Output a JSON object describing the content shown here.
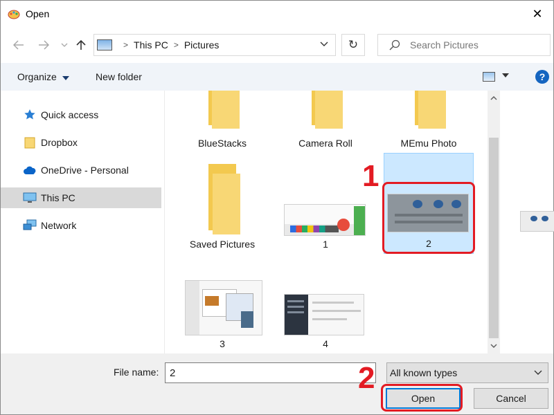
{
  "window": {
    "title": "Open",
    "close_glyph": "✕",
    "icon": "paint-app-icon"
  },
  "nav": {
    "back_icon": "back-arrow-icon",
    "forward_icon": "forward-arrow-icon",
    "recent_icon": "chevron-down-icon",
    "up_icon": "up-arrow-icon",
    "breadcrumb": [
      "This PC",
      "Pictures"
    ],
    "refresh_glyph": "↻",
    "search_placeholder": "Search Pictures"
  },
  "toolbar": {
    "organize_label": "Organize",
    "new_folder_label": "New folder",
    "help_label": "?"
  },
  "sidebar": {
    "items": [
      {
        "label": "Quick access",
        "icon": "star-icon",
        "selected": false
      },
      {
        "label": "Dropbox",
        "icon": "folder-icon",
        "selected": false
      },
      {
        "label": "OneDrive - Personal",
        "icon": "cloud-icon",
        "selected": false
      },
      {
        "label": "This PC",
        "icon": "monitor-icon",
        "selected": true
      },
      {
        "label": "Network",
        "icon": "network-icon",
        "selected": false
      }
    ]
  },
  "files": {
    "items": [
      {
        "label": "BlueStacks",
        "kind": "folder"
      },
      {
        "label": "Camera Roll",
        "kind": "folder"
      },
      {
        "label": "MEmu Photo",
        "kind": "folder"
      },
      {
        "label": "Saved Pictures",
        "kind": "folder"
      },
      {
        "label": "1",
        "kind": "image"
      },
      {
        "label": "2",
        "kind": "image",
        "selected": true
      },
      {
        "label": "3",
        "kind": "image"
      },
      {
        "label": "4",
        "kind": "image"
      }
    ]
  },
  "bottom": {
    "file_name_label": "File name:",
    "file_name_value": "2",
    "file_type_value": "All known types",
    "open_label": "Open",
    "cancel_label": "Cancel"
  },
  "annotations": {
    "step1": "1",
    "step2": "2",
    "color": "#e31b23"
  },
  "colors": {
    "accent": "#0078d7",
    "selection": "#cce8ff",
    "folder": "#f8d775"
  }
}
